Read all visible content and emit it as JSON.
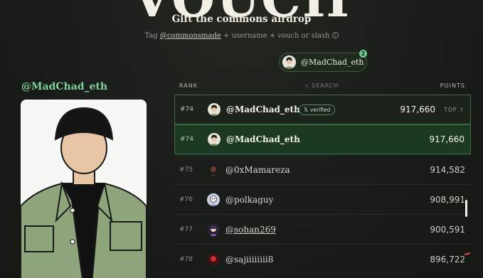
{
  "hero": {
    "title": "VOUCH"
  },
  "subtitle": "Gift the commons airdrop",
  "tagline": {
    "prefix": "Tag ",
    "handle": "@commonsmade",
    "rest": " + username + vouch or slash"
  },
  "pill": {
    "name": "@MadChad_eth",
    "badge": "2"
  },
  "profile": {
    "handle": "@MadChad_eth"
  },
  "leaderboard": {
    "headers": {
      "rank": "RANK",
      "search": "SEARCH",
      "points": "POINTS"
    },
    "rows": [
      {
        "rank": "#74",
        "name": "@MadChad_eth",
        "points": "917,660",
        "verified": "verified",
        "top": "TOP ↑"
      },
      {
        "rank": "#74",
        "name": "@MadChad_eth",
        "points": "917,660"
      },
      {
        "rank": "#75",
        "name": "@0xMamareza",
        "points": "914,582"
      },
      {
        "rank": "#76",
        "name": "@polkaguy",
        "points": "908,991"
      },
      {
        "rank": "#77",
        "name": "@sohan269",
        "points": "900,591"
      },
      {
        "rank": "#78",
        "name": "@sajiiiiiiii8",
        "points": "896,722"
      }
    ]
  },
  "colors": {
    "accent": "#7fd39a",
    "bg": "#1a1c19",
    "highlight": "#1c3a22"
  }
}
